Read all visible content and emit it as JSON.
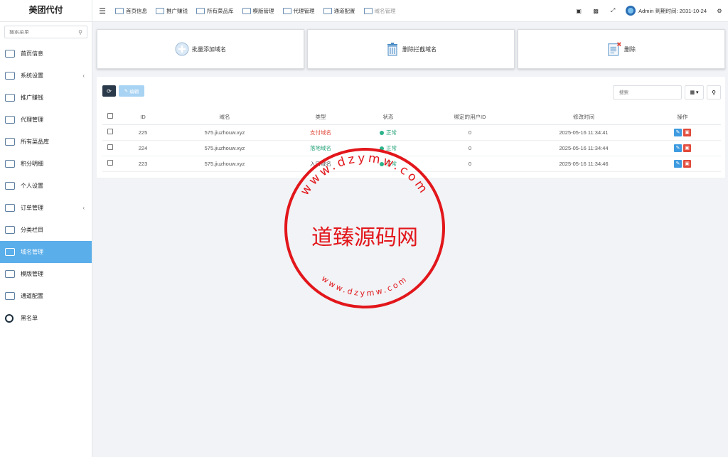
{
  "app": {
    "brand": "美团代付"
  },
  "sidebar": {
    "search_placeholder": "搜索菜单",
    "items": [
      {
        "label": "首页信息",
        "icon": "home-icon"
      },
      {
        "label": "系统设置",
        "icon": "settings-icon",
        "expandable": true
      },
      {
        "label": "推广赚钱",
        "icon": "promo-icon"
      },
      {
        "label": "代理管理",
        "icon": "agent-icon"
      },
      {
        "label": "所有菜品库",
        "icon": "dish-icon"
      },
      {
        "label": "积分明细",
        "icon": "points-icon"
      },
      {
        "label": "个人设置",
        "icon": "profile-icon"
      },
      {
        "label": "订单管理",
        "icon": "order-icon",
        "expandable": true
      },
      {
        "label": "分类栏目",
        "icon": "category-icon"
      },
      {
        "label": "域名管理",
        "icon": "domain-icon",
        "active": true
      },
      {
        "label": "模版管理",
        "icon": "template-icon"
      },
      {
        "label": "通道配置",
        "icon": "channel-icon"
      },
      {
        "label": "黑名单",
        "icon": "blacklist-icon"
      }
    ]
  },
  "topnav": {
    "items": [
      {
        "label": "首页信息"
      },
      {
        "label": "推广赚钱"
      },
      {
        "label": "所有菜品库"
      },
      {
        "label": "模版管理"
      },
      {
        "label": "代理管理"
      },
      {
        "label": "通道配置"
      },
      {
        "label": "域名管理",
        "muted": true
      }
    ],
    "user": "Admin",
    "expiry": "到期时间: 2031-10-24"
  },
  "cards": [
    {
      "label": "批量添加域名",
      "icon": "add-circle-icon"
    },
    {
      "label": "删除拦截域名",
      "icon": "trash-icon"
    },
    {
      "label": "删除",
      "icon": "document-delete-icon"
    }
  ],
  "toolbar": {
    "edit_label": "编辑",
    "search_placeholder": "搜索"
  },
  "table": {
    "headers": [
      "ID",
      "域名",
      "类型",
      "状态",
      "绑定的用户ID",
      "修改时间",
      "操作"
    ],
    "rows": [
      {
        "id": "225",
        "domain": "575.jiuzhouw.xyz",
        "type": "支付域名",
        "type_class": "type-pay",
        "status": "正常",
        "user_id": "0",
        "time": "2025-05-16 11:34:41"
      },
      {
        "id": "224",
        "domain": "575.jiuzhouw.xyz",
        "type": "落地域名",
        "type_class": "type-land",
        "status": "正常",
        "user_id": "0",
        "time": "2025-05-16 11:34:44"
      },
      {
        "id": "223",
        "domain": "575.jiuzhouw.xyz",
        "type": "入口域名",
        "type_class": "type-entry",
        "status": "正常",
        "user_id": "0",
        "time": "2025-05-16 11:34:46"
      }
    ]
  },
  "watermark": {
    "text": "道臻源码网",
    "site": "www.dzymw.com"
  }
}
